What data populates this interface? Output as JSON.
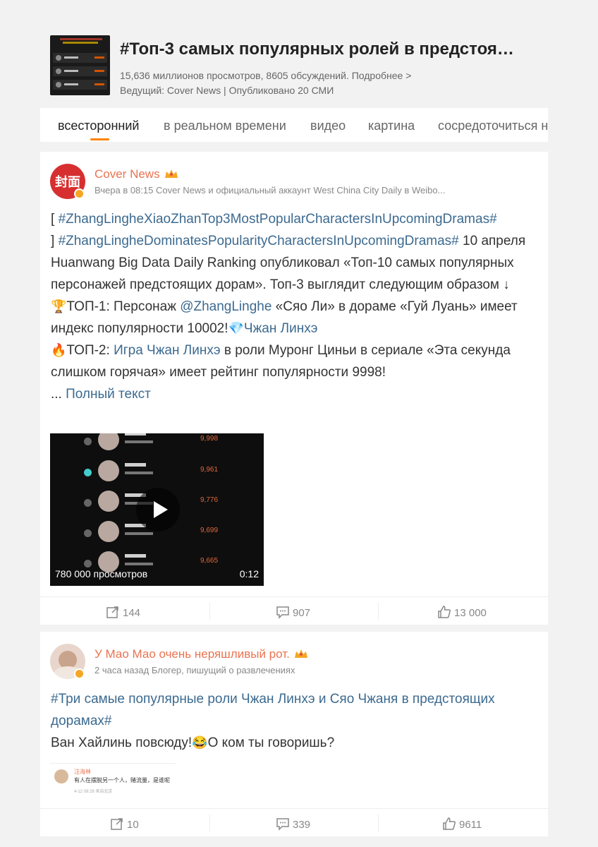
{
  "topic": {
    "title": "#Топ-3 самых популярных ролей в предстоя…",
    "stats": "15,636 миллионов просмотров, 8605 обсуждений. Подробнее >",
    "host": "Ведущий: Cover News | Опубликовано 20 СМИ"
  },
  "tabs": [
    {
      "label": "всесторонний",
      "active": true
    },
    {
      "label": "в реальном времени"
    },
    {
      "label": "видео"
    },
    {
      "label": "картина"
    },
    {
      "label": "сосредоточиться на"
    }
  ],
  "posts": [
    {
      "author": "Cover News",
      "avatar_text": "封面",
      "meta": "Вчера в 08:15 Cover News и официальный аккаунт West China City Daily в Weibo...",
      "bracket_open": "[",
      "tag1": "#ZhangLingheXiaoZhanTop3MostPopularCharactersInUpcomingDramas#",
      "bracket_close": "]",
      "tag2": "#ZhangLingheDominatesPopularityCharactersInUpcomingDramas#",
      "text1": "10 апреля Huanwang Big Data Daily Ranking опубликовал «Топ-10 самых популярных персонажей предстоящих дорам». Топ-3 выглядит следующим образом ↓",
      "top1_icon": "🏆",
      "top1_prefix": "ТОП-1: Персонаж ",
      "top1_mention": "@ZhangLinghe",
      "top1_text": " «Сяо Ли» в дораме «Гуй Луань» имеет индекс популярности 10002!",
      "top1_diamond": "💎",
      "top1_link": "Чжан Линхэ",
      "top2_icon": "🔥",
      "top2_prefix": "ТОП-2: ",
      "top2_link": "Игра Чжан Линхэ",
      "top2_text": " в роли Муронг Циньи в сериале «Эта секунда слишком горячая» имеет рейтинг популярности 9998!",
      "ellipsis": "... ",
      "full_text": "Полный текст",
      "video": {
        "views": "780 000 просмотров",
        "duration": "0:12",
        "scores": [
          "9,998",
          "9,961",
          "9,776",
          "9,699",
          "9,665"
        ]
      },
      "reposts": "144",
      "comments": "907",
      "likes": "13 000"
    },
    {
      "author": "У Мао Мао очень неряшливый рот.",
      "meta": "2 часа назад Блогер, пишущий о развлечениях",
      "tag": "#Три самые популярные роли Чжан Линхэ и Сяо Чжаня в предстоящих дорамах#",
      "text1": "Ван Хайлинь повсюду!",
      "emoji": "😂",
      "text2": "О ком ты говоришь?",
      "embedded": {
        "name": "汪海林",
        "text": "有人在摆脱另一个人，赌流量，是谁呢",
        "meta": "4-12 09:29 来自北京"
      },
      "reposts": "10",
      "comments": "339",
      "likes": "9611"
    }
  ],
  "colors": {
    "accent": "#ff8200",
    "author": "#eb7350",
    "link": "#3c6a90",
    "background": "#f2f2f2"
  }
}
